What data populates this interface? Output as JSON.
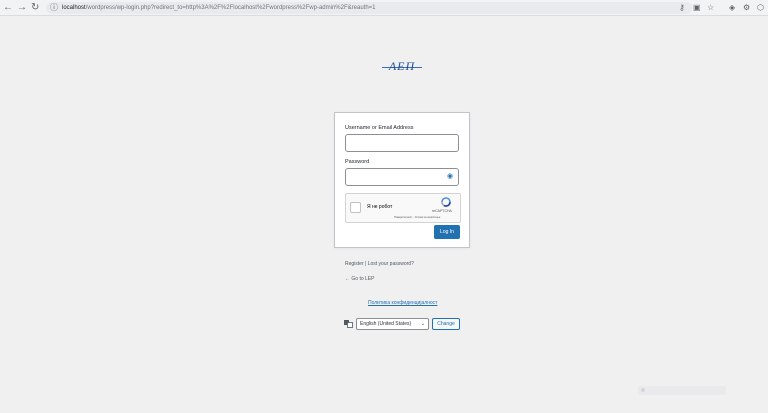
{
  "browser": {
    "url_host": "localhost",
    "url_path": "/wordpress/wp-login.php?redirect_to=http%3A%2F%2Flocalhost%2Fwordpress%2Fwp-admin%2F&reauth=1",
    "back_icon": "arrow-left-icon",
    "forward_icon": "arrow-right-icon",
    "reload_icon": "reload-icon"
  },
  "logo": {
    "text": "АЕП"
  },
  "form": {
    "username_label": "Username or Email Address",
    "username_value": "",
    "password_label": "Password",
    "password_value": "",
    "captcha": {
      "checkbox_label": "Я не робот",
      "brand": "reCAPTCHA",
      "links": "Поверителност - Услови за користење"
    },
    "login_button": "Log In"
  },
  "links": {
    "register": "Register",
    "separator": "|",
    "lost_password": "Lost your password?",
    "back_to_site": "← Go to LEP",
    "privacy_policy": "Политика конфиденцијалност"
  },
  "language": {
    "selected": "English (United States)",
    "change_button": "Change"
  },
  "colors": {
    "primary": "#2271b1",
    "background": "#f0f0f1"
  }
}
